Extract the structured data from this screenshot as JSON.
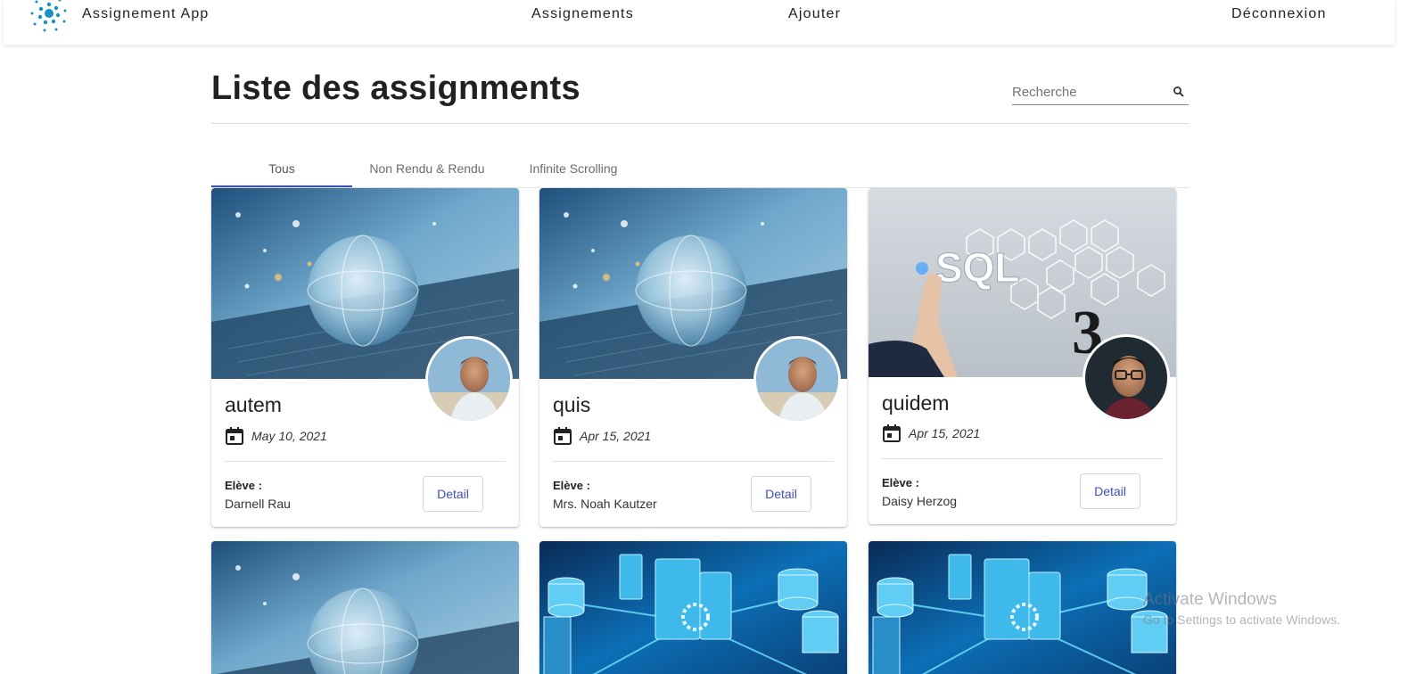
{
  "navbar": {
    "brand_title": "Assignement App",
    "links": {
      "assignements": "Assignements",
      "ajouter": "Ajouter",
      "deconnexion": "Déconnexion"
    },
    "logo_icon": "dotted-circle-logo-icon",
    "accent": "#1a8fc4"
  },
  "header": {
    "title": "Liste des assignments"
  },
  "search": {
    "placeholder": "Recherche",
    "value": ""
  },
  "tabs": [
    {
      "label": "Tous",
      "active": true
    },
    {
      "label": "Non Rendu & Rendu",
      "active": false
    },
    {
      "label": "Infinite Scrolling",
      "active": false
    }
  ],
  "colors": {
    "tab_ink": "#3f51b5",
    "detail_text": "#3f51b5"
  },
  "cards": [
    {
      "name": "autem",
      "date": "May 10, 2021",
      "eleve_label": "Elève :",
      "eleve_name": "Darnell Rau",
      "detail_label": "Detail",
      "image": "globe-laptop-image",
      "avatar": "man-beach-avatar"
    },
    {
      "name": "quis",
      "date": "Apr 15, 2021",
      "eleve_label": "Elève :",
      "eleve_name": "Mrs. Noah Kautzer",
      "detail_label": "Detail",
      "image": "globe-laptop-image",
      "avatar": "man-beach-avatar"
    },
    {
      "name": "quidem",
      "date": "Apr 15, 2021",
      "eleve_label": "Elève :",
      "eleve_name": "Daisy Herzog",
      "detail_label": "Detail",
      "image": "sql-hexagon-image",
      "avatar": "man-glasses-avatar"
    }
  ],
  "lower_cards": [
    {
      "image": "globe-laptop-image"
    },
    {
      "image": "database-network-image"
    },
    {
      "image": "database-network-image"
    }
  ],
  "watermark": {
    "line1": "Activate Windows",
    "line2": "Go to Settings to activate Windows."
  }
}
